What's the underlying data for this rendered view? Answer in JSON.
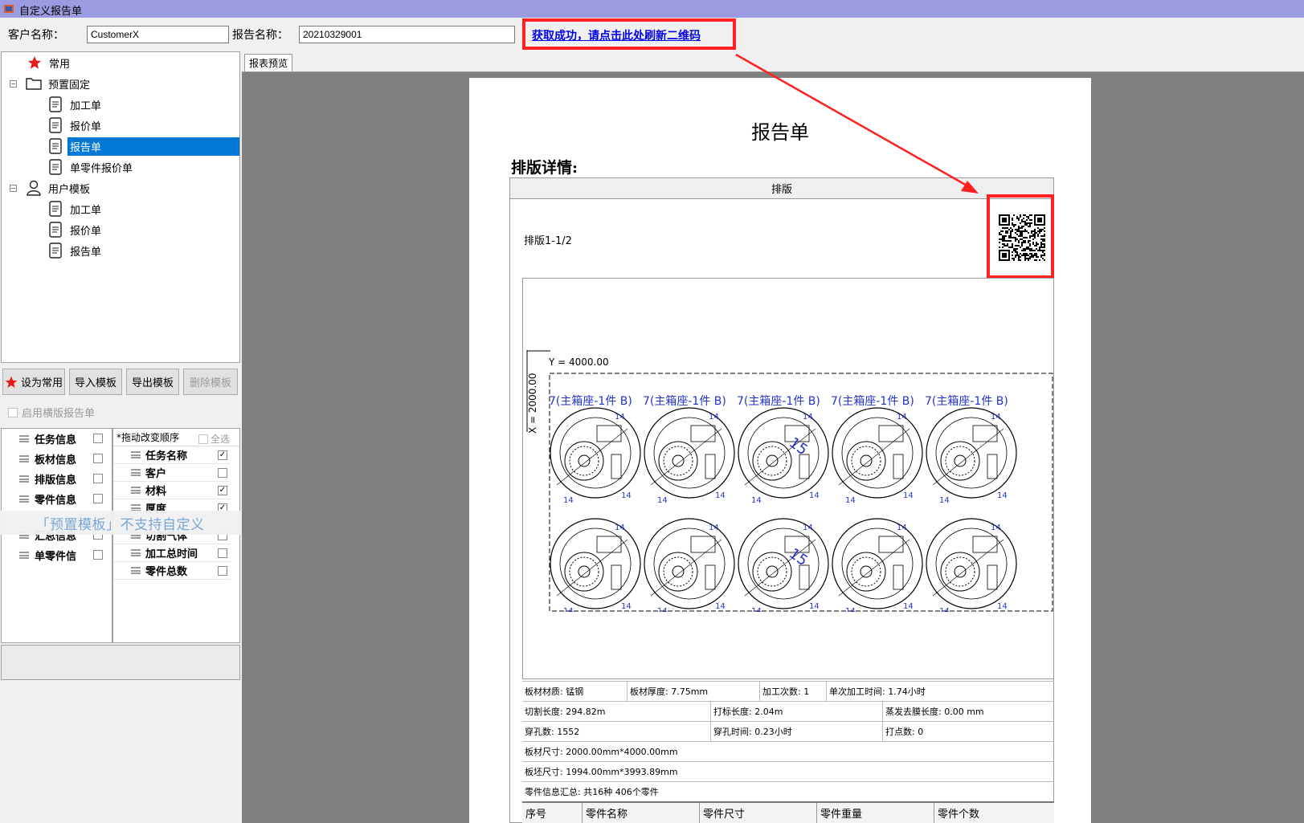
{
  "window": {
    "title": "自定义报告单"
  },
  "form": {
    "customer_label": "客户名称：",
    "customer_value": "CustomerX",
    "report_label": "报告名称：",
    "report_value": "20210329001",
    "refresh_link": "获取成功，请点击此处刷新二维码"
  },
  "tree": {
    "common": "常用",
    "preset": "预置固定",
    "preset_items": [
      "加工单",
      "报价单",
      "报告单",
      "单零件报价单"
    ],
    "user": "用户模板",
    "user_items": [
      "加工单",
      "报价单",
      "报告单"
    ]
  },
  "toolbar": {
    "set_common": "设为常用",
    "import": "导入模板",
    "export": "导出模板",
    "delete": "删除模板"
  },
  "enable_label": "启用横版报告单",
  "categories": [
    {
      "label": "任务信息",
      "checked": false
    },
    {
      "label": "板材信息",
      "checked": false
    },
    {
      "label": "排版信息",
      "checked": false
    },
    {
      "label": "零件信息",
      "checked": false
    },
    {
      "label": "汇总信息",
      "checked": false
    },
    {
      "label": "单零件信",
      "checked": false
    }
  ],
  "fields_header": "*拖动改变顺序",
  "select_all": "全选",
  "fields": [
    {
      "label": "任务名称",
      "checked": true
    },
    {
      "label": "客户",
      "checked": false
    },
    {
      "label": "材料",
      "checked": true
    },
    {
      "label": "厚度",
      "checked": true
    },
    {
      "label": "切割气体",
      "checked": false
    },
    {
      "label": "加工总时间",
      "checked": false
    },
    {
      "label": "零件总数",
      "checked": false
    }
  ],
  "overlay_msg": "「预置模板」不支持自定义",
  "preview": {
    "tab": "报表预览",
    "report_title": "报告单",
    "section_title": "排版详情:",
    "layout_header": "排版",
    "sheet_label": "排版1-1/2",
    "y_dim": "Y = 4000.00",
    "x_dim": "X = 2000.00",
    "part_label": "7(主箱座-1件 B)",
    "part_numbers": [
      "14",
      "15"
    ],
    "info": {
      "material": "板材材质: 锰钢",
      "thickness": "板材厚度: 7.75mm",
      "process_count": "加工次数: 1",
      "single_time": "单次加工时间: 1.74小时",
      "cut_length": "切割长度: 294.82m",
      "mark_length": "打标长度: 2.04m",
      "evap_length": "蒸发去膜长度: 0.00 mm",
      "pierce_count": "穿孔数: 1552",
      "pierce_time": "穿孔时间: 0.23小时",
      "dot_count": "打点数: 0",
      "sheet_size": "板材尺寸:  2000.00mm*4000.00mm",
      "blank_size": "板坯尺寸:  1994.00mm*3993.89mm",
      "parts_summary": "零件信息汇总:  共16种 406个零件"
    },
    "parts_columns": [
      "序号",
      "零件名称",
      "零件尺寸",
      "零件重量",
      "零件个数"
    ]
  },
  "colors": {
    "titlebar": "#9b9be2",
    "highlight": "#ff2020",
    "selection": "#0078d7",
    "link": "#0000ee"
  }
}
